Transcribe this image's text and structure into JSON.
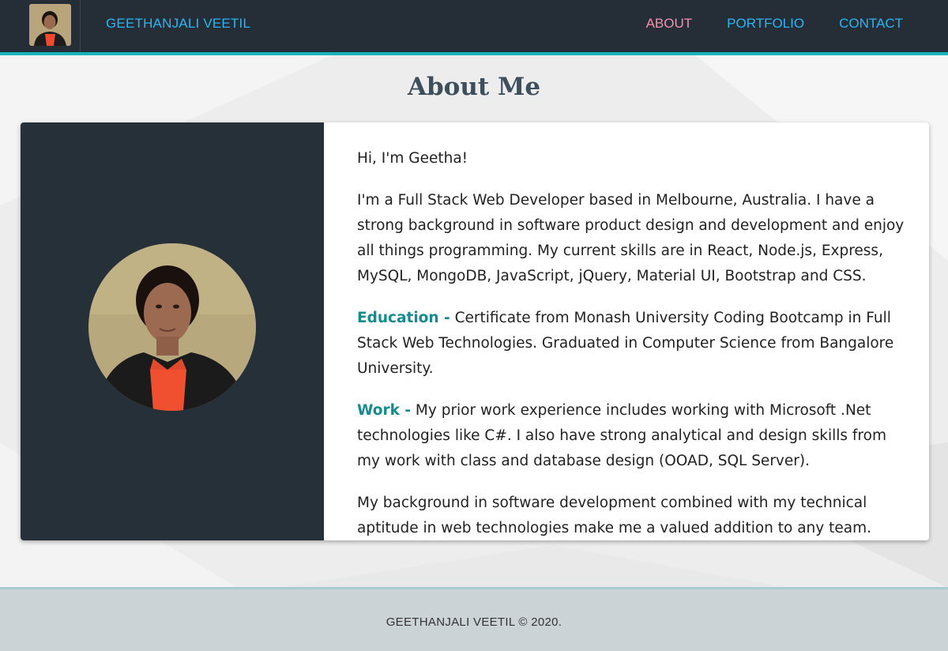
{
  "navbar": {
    "brand_name": "GEETHANJALI VEETIL",
    "links": [
      {
        "label": "ABOUT",
        "active": true
      },
      {
        "label": "PORTFOLIO",
        "active": false
      },
      {
        "label": "CONTACT",
        "active": false
      }
    ]
  },
  "main": {
    "title": "About Me",
    "greeting": "Hi, I'm Geetha!",
    "intro": "I'm a Full Stack Web Developer based in Melbourne, Australia. I have a strong background in software product design and development and enjoy all things programming. My current skills are in React, Node.js, Express, MySQL, MongoDB, JavaScript, jQuery, Material UI, Bootstrap and CSS.",
    "education_label": "Education -",
    "education_text": "Certificate from Monash University Coding Bootcamp in Full Stack Web Technologies. Graduated in Computer Science from Bangalore University.",
    "work_label": "Work -",
    "work_text": "My prior work experience includes working with Microsoft .Net technologies like C#. I also have strong analytical and design skills from my work with class and database design (OOAD, SQL Server).",
    "closing": "My background in software development combined with my technical aptitude in web technologies make me a valued addition to any team."
  },
  "footer": {
    "text": "GEETHANJALI VEETIL © 2020."
  },
  "colors": {
    "navbar_bg": "#252e36",
    "accent_teal": "#17b3b8",
    "link_blue": "#29b6f6",
    "active_pink": "#f48fb1",
    "label_teal": "#158a90"
  }
}
